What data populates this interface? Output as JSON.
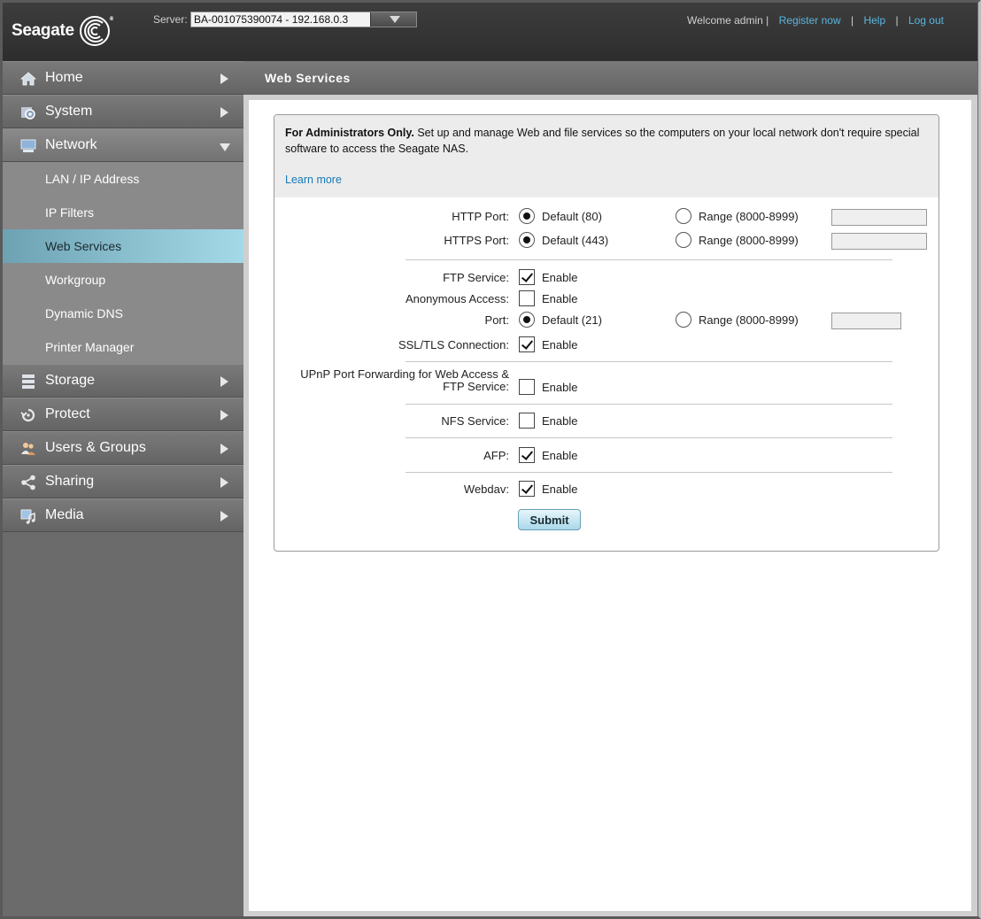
{
  "header": {
    "logo_text": "Seagate",
    "server_label": "Server:",
    "server_value": "BA-001075390074 - 192.168.0.3",
    "welcome": "Welcome admin |",
    "links": [
      "Register now",
      "Help",
      "Log out"
    ]
  },
  "sidebar": {
    "items": [
      {
        "label": "Home",
        "icon": "home-icon"
      },
      {
        "label": "System",
        "icon": "gear-icon"
      },
      {
        "label": "Network",
        "icon": "network-icon",
        "open": true
      },
      {
        "label": "Storage",
        "icon": "storage-icon"
      },
      {
        "label": "Protect",
        "icon": "protect-icon"
      },
      {
        "label": "Users & Groups",
        "icon": "users-icon"
      },
      {
        "label": "Sharing",
        "icon": "share-icon"
      },
      {
        "label": "Media",
        "icon": "media-icon"
      }
    ],
    "network_sub": [
      "LAN / IP Address",
      "IP Filters",
      "Web Services",
      "Workgroup",
      "Dynamic DNS",
      "Printer Manager"
    ],
    "active_sub": "Web Services"
  },
  "page": {
    "title": "Web Services",
    "intro_bold": "For Administrators Only.",
    "intro_text": " Set up and manage Web and file services so the computers on your local network don't require special software to access the Seagate NAS.",
    "learn_more": "Learn more"
  },
  "form": {
    "http_label": "HTTP Port:",
    "https_label": "HTTPS Port:",
    "default_80": "Default (80)",
    "default_443": "Default (443)",
    "range": "Range (8000-8999)",
    "ftp_label": "FTP Service:",
    "anon_label": "Anonymous Access:",
    "port_label": "Port:",
    "default_21": "Default (21)",
    "ssl_label": "SSL/TLS Connection:",
    "upnp_label_1": "UPnP Port Forwarding for Web Access &",
    "upnp_label_2": "FTP Service:",
    "nfs_label": "NFS Service:",
    "afp_label": "AFP:",
    "webdav_label": "Webdav:",
    "enable": "Enable",
    "submit": "Submit",
    "ftp_enabled": true,
    "anon_enabled": false,
    "ssl_enabled": true,
    "upnp_enabled": false,
    "nfs_enabled": false,
    "afp_enabled": true,
    "webdav_enabled": true
  },
  "colors": {
    "accent_link": "#59b6e0",
    "active_nav": "#a4d9e8",
    "header_bg": "#333333"
  }
}
